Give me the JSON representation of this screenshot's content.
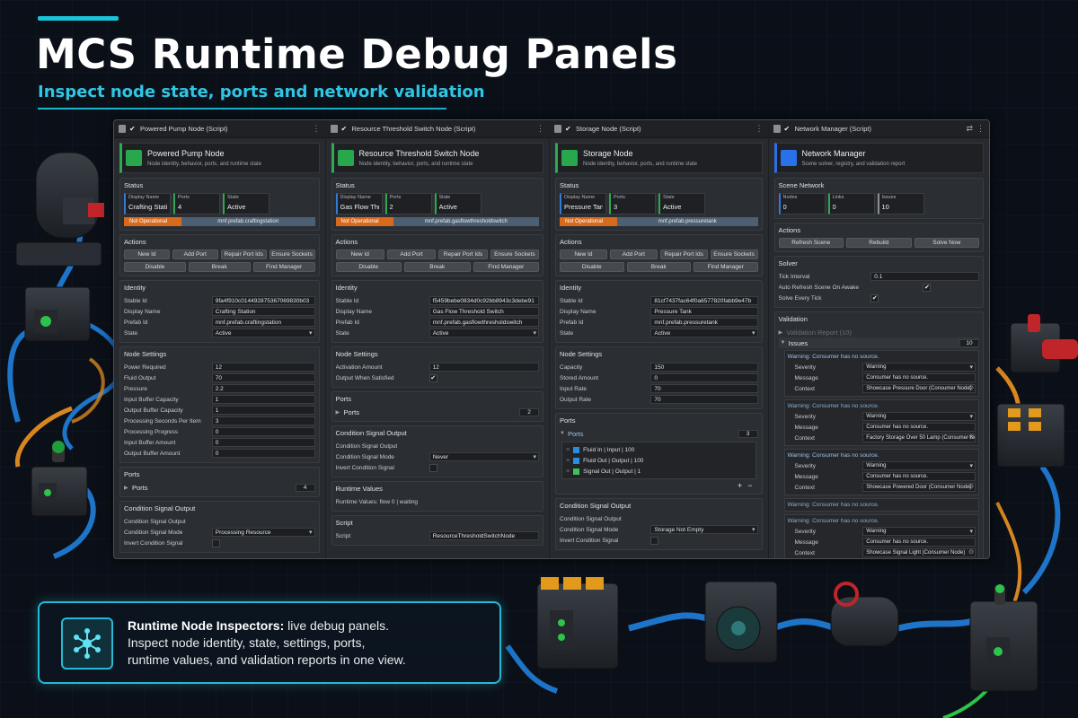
{
  "hero": {
    "title": "MCS Runtime Debug Panels",
    "subtitle": "Inspect node state, ports and network validation"
  },
  "colors": {
    "accent": "#19c3d8",
    "status_green": "#27a84d",
    "status_blue": "#2a70e8",
    "status_orange": "#d86a1d"
  },
  "panels": {
    "pump": {
      "tab": "Powered Pump Node (Script)",
      "name": "Powered Pump Node",
      "desc": "Node identity, behavior, ports, and runtime state",
      "status_label": "Status",
      "s1_label": "Display Name",
      "s1_value": "Crafting Station",
      "s2_label": "Ports",
      "s2_value": "4",
      "s3_label": "State",
      "s3_value": "Active",
      "bar_left": "Not Operational",
      "bar_right": "mnf.prefab.craftingstation",
      "actions_label": "Actions",
      "btn": [
        "New Id",
        "Add Port",
        "Repair Port Ids",
        "Ensure Sockets",
        "Disable",
        "Break",
        "Find Manager"
      ],
      "identity_label": "Identity",
      "identity": [
        {
          "label": "Stable Id",
          "value": "9fa4f910c014492875367069830b03"
        },
        {
          "label": "Display Name",
          "value": "Crafting Station"
        },
        {
          "label": "Prefab Id",
          "value": "mnf.prefab.craftingstation"
        },
        {
          "label": "State",
          "value": "Active"
        }
      ],
      "settings_label": "Node Settings",
      "settings": [
        {
          "label": "Power Required",
          "value": "12"
        },
        {
          "label": "Fluid Output",
          "value": "70"
        },
        {
          "label": "Pressure",
          "value": "2.2"
        },
        {
          "label": "Input Buffer Capacity",
          "value": "1"
        },
        {
          "label": "Output Buffer Capacity",
          "value": "1"
        },
        {
          "label": "Processing Seconds Per Item",
          "value": "3"
        },
        {
          "label": "Processing Progress",
          "value": "0"
        },
        {
          "label": "Input Buffer Amount",
          "value": "0"
        },
        {
          "label": "Output Buffer Amount",
          "value": "0"
        }
      ],
      "ports_label": "Ports",
      "ports_fold": "Ports",
      "ports_count": "4",
      "cond_label": "Condition Signal Output",
      "cond_out": "Condition Signal Output",
      "cond_mode_label": "Condition Signal Mode",
      "cond_mode": "Processing Resource",
      "cond_inv": "Invert Condition Signal"
    },
    "switch": {
      "tab": "Resource Threshold Switch Node (Script)",
      "name": "Resource Threshold Switch Node",
      "desc": "Node identity, behavior, ports, and runtime state",
      "status_label": "Status",
      "s1_label": "Display Name",
      "s1_value": "Gas Flow Threshold Switch",
      "s2_label": "Ports",
      "s2_value": "2",
      "s3_label": "State",
      "s3_value": "Active",
      "bar_left": "Not Operational",
      "bar_right": "mnf.prefab.gasflowthresholdswitch",
      "actions_label": "Actions",
      "btn": [
        "New Id",
        "Add Port",
        "Repair Port Ids",
        "Ensure Sockets",
        "Disable",
        "Break",
        "Find Manager"
      ],
      "identity_label": "Identity",
      "identity": [
        {
          "label": "Stable Id",
          "value": "f5459bebe0834d0c92bb8943c3debe91"
        },
        {
          "label": "Display Name",
          "value": "Gas Flow Threshold Switch"
        },
        {
          "label": "Prefab Id",
          "value": "mnf.prefab.gasflowthresholdswitch"
        },
        {
          "label": "State",
          "value": "Active"
        }
      ],
      "settings_label": "Node Settings",
      "activation_label": "Activation Amount",
      "activation_value": "12",
      "ows_label": "Output When Satisfied",
      "ports_label": "Ports",
      "ports_fold": "Ports",
      "ports_count": "2",
      "cond_label": "Condition Signal Output",
      "cond_out": "Condition Signal Output",
      "cond_mode_label": "Condition Signal Mode",
      "cond_mode": "Never",
      "cond_inv": "Invert Condition Signal",
      "runtime_label": "Runtime Values",
      "runtime_value": "Runtime Values: flow 0 | waiting",
      "script_label": "Script",
      "script_field": "Script",
      "script_value": "ResourceThresholdSwitchNode"
    },
    "storage": {
      "tab": "Storage Node (Script)",
      "name": "Storage Node",
      "desc": "Node identity, behavior, ports, and runtime state",
      "status_label": "Status",
      "s1_label": "Display Name",
      "s1_value": "Pressure Tank",
      "s2_label": "Ports",
      "s2_value": "3",
      "s3_label": "State",
      "s3_value": "Active",
      "bar_left": "Not Operational",
      "bar_right": "mnf.prefab.pressuretank",
      "actions_label": "Actions",
      "btn": [
        "New Id",
        "Add Port",
        "Repair Port Ids",
        "Ensure Sockets",
        "Disable",
        "Break",
        "Find Manager"
      ],
      "identity_label": "Identity",
      "identity": [
        {
          "label": "Stable Id",
          "value": "81cf7437fac64f0a6577820fabb9e47b"
        },
        {
          "label": "Display Name",
          "value": "Pressure Tank"
        },
        {
          "label": "Prefab Id",
          "value": "mnf.prefab.pressuretank"
        },
        {
          "label": "State",
          "value": "Active"
        }
      ],
      "settings_label": "Node Settings",
      "settings": [
        {
          "label": "Capacity",
          "value": "150"
        },
        {
          "label": "Stored Amount",
          "value": "0"
        },
        {
          "label": "Input Rate",
          "value": "70"
        },
        {
          "label": "Output Rate",
          "value": "70"
        }
      ],
      "ports_label": "Ports",
      "ports_fold": "Ports",
      "ports_count": "3",
      "ports": [
        {
          "text": "Fluid In  |  Input  |  100"
        },
        {
          "text": "Fluid Out  |  Output  |  100"
        },
        {
          "text": "Signal Out  |  Output  |  1"
        }
      ],
      "cond_label": "Condition Signal Output",
      "cond_out": "Condition Signal Output",
      "cond_mode_label": "Condition Signal Mode",
      "cond_mode": "Storage Not Empty",
      "cond_inv": "Invert Condition Signal"
    },
    "network": {
      "tab": "Network Manager (Script)",
      "name": "Network Manager",
      "desc": "Scene solver, registry, and validation report",
      "scene_label": "Scene Network",
      "s1_label": "Nodes",
      "s1_value": "0",
      "s2_label": "Links",
      "s2_value": "0",
      "s3_label": "Issues",
      "s3_value": "10",
      "actions_label": "Actions",
      "btn": [
        "Refresh Scene",
        "Rebuild",
        "Solve Now"
      ],
      "solver_label": "Solver",
      "tick_label": "Tick Interval",
      "tick_value": "0.1",
      "auto_label": "Auto Refresh Scene On Awake",
      "solve_label": "Solve Every Tick",
      "validation_label": "Validation",
      "report_label": "Validation Report (10)",
      "issues_label": "Issues",
      "issues_count": "10",
      "issues": [
        {
          "title": "Warning: Consumer has no source.",
          "severity": "Warning",
          "message": "Consumer has no source.",
          "context": "Showcase Pressure Door (Consumer Node)"
        },
        {
          "title": "Warning: Consumer has no source.",
          "severity": "Warning",
          "message": "Consumer has no source.",
          "context": "Factory Storage Over 50 Lamp (Consumer Node)"
        },
        {
          "title": "Warning: Consumer has no source.",
          "severity": "Warning",
          "message": "Consumer has no source.",
          "context": "Showcase Powered Door (Consumer Node)"
        },
        {
          "title": "Warning: Consumer has no source.",
          "severity": "Warning",
          "message": "Consumer has no source.",
          "context": "Showcase Signal Light (Consumer Node)"
        }
      ],
      "collapsed_issue": "Warning: Consumer has no source.",
      "sev_label": "Severity",
      "msg_label": "Message",
      "ctx_label": "Context"
    }
  },
  "callout": {
    "heading": "Runtime Node Inspectors:",
    "rest": "live debug panels.",
    "line2": "Inspect node identity, state, settings, ports,",
    "line3": "runtime values, and validation reports in one view."
  }
}
